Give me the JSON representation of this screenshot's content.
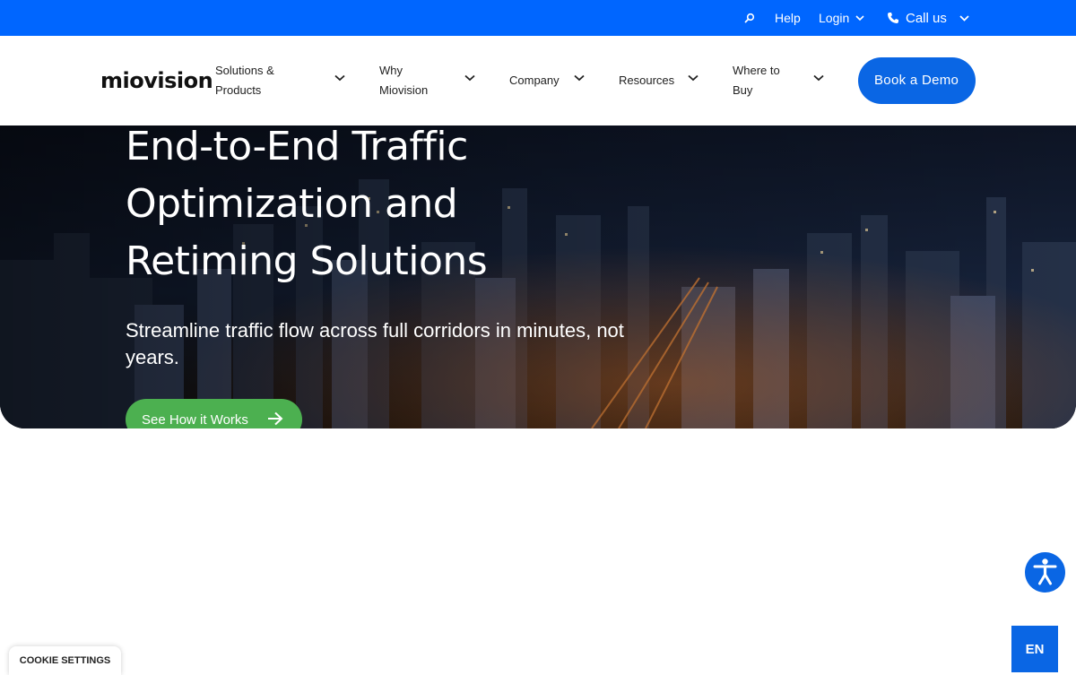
{
  "topbar": {
    "search_icon": "search-icon",
    "help": "Help",
    "login": "Login",
    "call_us": "Call us",
    "accent_color": "#0066ff"
  },
  "header": {
    "logo_text": "miovision",
    "nav": [
      {
        "label": "Solutions & Products"
      },
      {
        "label": "Why Miovision"
      },
      {
        "label": "Company"
      },
      {
        "label": "Resources"
      },
      {
        "label": "Where to Buy"
      }
    ],
    "demo_button": "Book a Demo",
    "button_color": "#0a66e4"
  },
  "hero": {
    "title": "End-to-End Traffic Optimization and Retiming Solutions",
    "subtitle": "Streamline traffic flow across full corridors in minutes, not years.",
    "cta": "See How it Works",
    "cta_color": "#4cb050"
  },
  "widgets": {
    "accessibility_icon": "accessibility-icon",
    "language": "EN",
    "cookie_settings": "COOKIE SETTINGS"
  }
}
